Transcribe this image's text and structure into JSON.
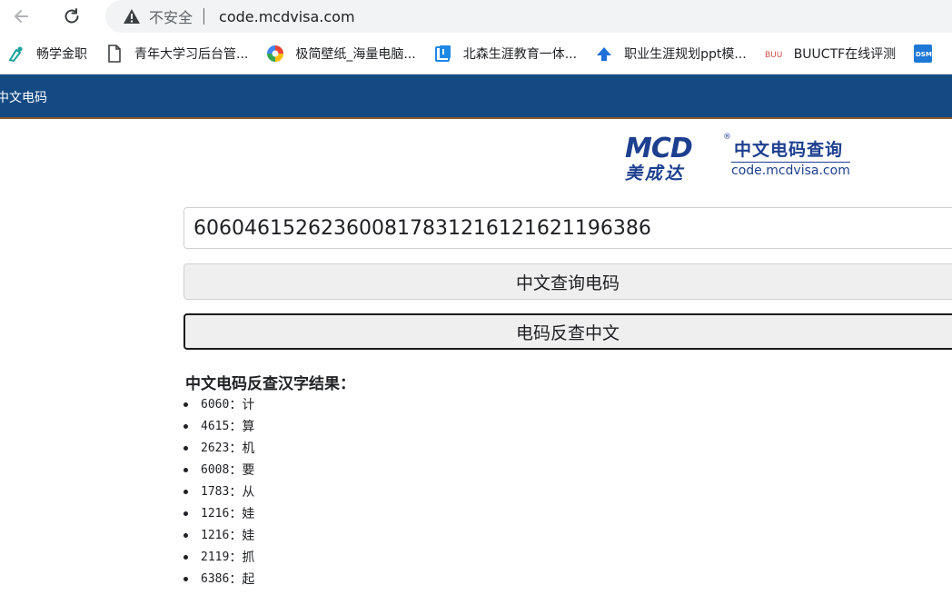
{
  "browser": {
    "insecure_label": "不安全",
    "url": "code.mcdvisa.com"
  },
  "bookmarks": [
    {
      "label": "畅学金职",
      "icon": "pen-nib-icon"
    },
    {
      "label": "青年大学习后台管...",
      "icon": "document-icon"
    },
    {
      "label": "极简壁纸_海量电脑...",
      "icon": "pinwheel-icon"
    },
    {
      "label": "北森生涯教育一体...",
      "icon": "book-icon"
    },
    {
      "label": "职业生涯规划ppt模...",
      "icon": "arrow-logo-icon"
    },
    {
      "label": "BUUCTF在线评测",
      "icon": "buu-icon"
    },
    {
      "label": "",
      "icon": "dsm-icon"
    }
  ],
  "site": {
    "nav_title": "中文电码",
    "logo": {
      "brand": "MCD",
      "brand_cn": "美成达",
      "title": "中文电码查询",
      "domain": "code.mcdvisa.com"
    }
  },
  "form": {
    "input_value": "606046152623600817831216121621196386",
    "btn_chinese_to_code": "中文查询电码",
    "btn_code_to_chinese": "电码反查中文"
  },
  "results": {
    "title": "中文电码反查汉字结果：",
    "items": [
      {
        "code": "6060",
        "sep": "：",
        "char": "计"
      },
      {
        "code": "4615",
        "sep": "：",
        "char": "算"
      },
      {
        "code": "2623",
        "sep": "：",
        "char": "机"
      },
      {
        "code": "6008",
        "sep": "：",
        "char": "要"
      },
      {
        "code": "1783",
        "sep": "：",
        "char": "从"
      },
      {
        "code": "1216",
        "sep": "：",
        "char": "娃"
      },
      {
        "code": "1216",
        "sep": "：",
        "char": "娃"
      },
      {
        "code": "2119",
        "sep": "：",
        "char": "抓"
      },
      {
        "code": "6386",
        "sep": "：",
        "char": "起"
      }
    ]
  },
  "colors": {
    "nav_bg": "#134a83",
    "logo_blue": "#1d3f8f"
  }
}
